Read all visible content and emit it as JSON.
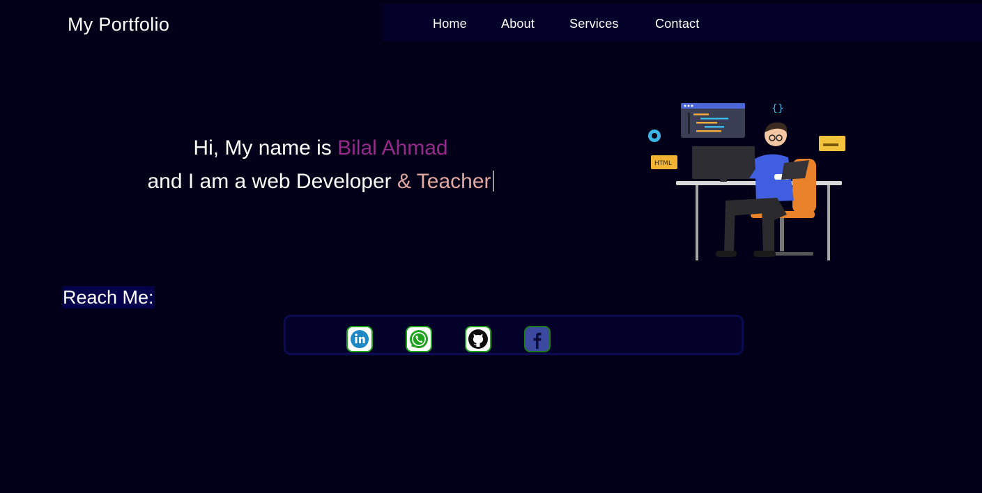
{
  "header": {
    "brand": "My Portfolio",
    "nav": [
      {
        "label": "Home"
      },
      {
        "label": "About"
      },
      {
        "label": "Services"
      },
      {
        "label": "Contact"
      }
    ]
  },
  "hero": {
    "line1_prefix": "Hi, My name is ",
    "name": "Bilal Ahmad",
    "line2_prefix": "and I am a web Developer ",
    "role": "& Teacher",
    "illustration_icon": "developer-at-desk-illustration"
  },
  "contact": {
    "heading": "Reach Me:",
    "socials": [
      {
        "icon": "linkedin-icon"
      },
      {
        "icon": "whatsapp-icon"
      },
      {
        "icon": "github-icon"
      },
      {
        "icon": "facebook-icon"
      }
    ]
  },
  "colors": {
    "background": "#010018",
    "navbar": "#03002a",
    "name_accent": "#962a8a",
    "role_accent": "#e3a8a1",
    "social_border": "#1fa31f"
  }
}
